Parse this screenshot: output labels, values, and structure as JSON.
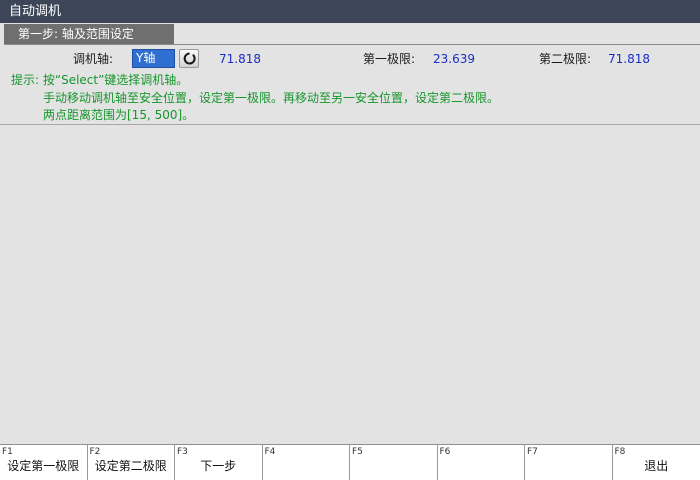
{
  "window": {
    "title": "自动调机"
  },
  "step": {
    "tab_label": "第一步: 轴及范围设定"
  },
  "axis": {
    "label": "调机轴:",
    "selected": "Y轴",
    "current_value": "71.818"
  },
  "limits": {
    "first_label": "第一极限:",
    "first_value": "23.639",
    "second_label": "第二极限:",
    "second_value": "71.818"
  },
  "hints": {
    "line1": "提示: 按“Select”键选择调机轴。",
    "line2": "手动移动调机轴至安全位置，设定第一极限。再移动至另一安全位置，设定第二极限。",
    "line3": "两点距离范围为[15, 500]。"
  },
  "fkeys": [
    {
      "num": "F1",
      "label": "设定第一极限"
    },
    {
      "num": "F2",
      "label": "设定第二极限"
    },
    {
      "num": "F3",
      "label": "下一步"
    },
    {
      "num": "F4",
      "label": ""
    },
    {
      "num": "F5",
      "label": ""
    },
    {
      "num": "F6",
      "label": ""
    },
    {
      "num": "F7",
      "label": ""
    },
    {
      "num": "F8",
      "label": "退出"
    }
  ],
  "colors": {
    "titlebar": "#3c4658",
    "tab": "#6f6f6f",
    "value_blue": "#1b2ec4",
    "hint_green": "#16962c",
    "select_blue": "#2f6fd1"
  },
  "icons": {
    "refresh": "refresh-icon"
  }
}
